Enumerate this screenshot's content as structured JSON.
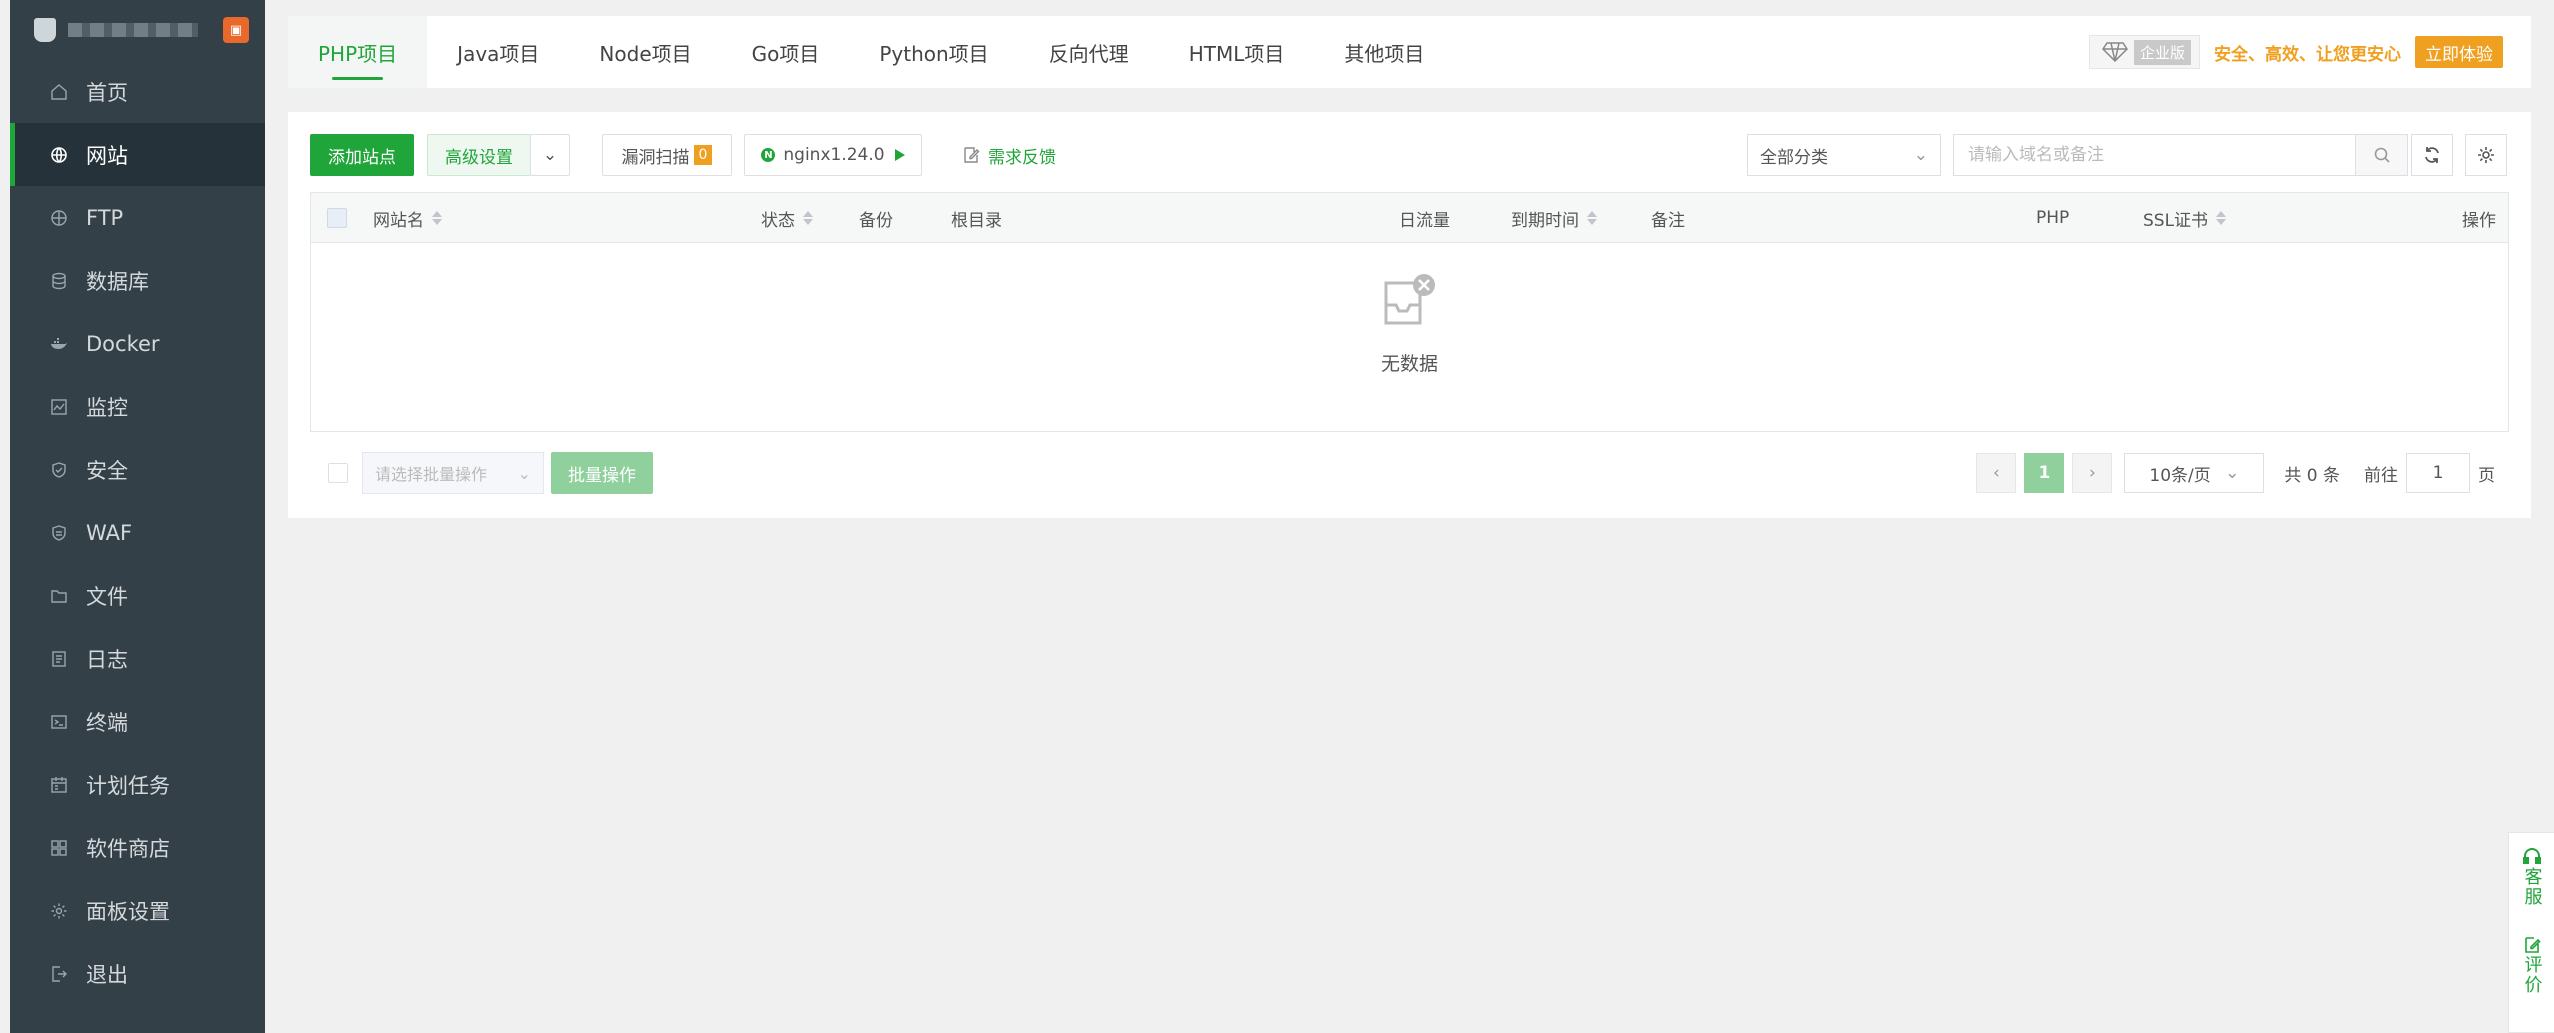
{
  "sidebar": {
    "items": [
      {
        "label": "首页",
        "icon": "home-icon"
      },
      {
        "label": "网站",
        "icon": "globe-icon"
      },
      {
        "label": "FTP",
        "icon": "ftp-icon"
      },
      {
        "label": "数据库",
        "icon": "database-icon"
      },
      {
        "label": "Docker",
        "icon": "docker-icon"
      },
      {
        "label": "监控",
        "icon": "monitor-icon"
      },
      {
        "label": "安全",
        "icon": "shield-icon"
      },
      {
        "label": "WAF",
        "icon": "waf-icon"
      },
      {
        "label": "文件",
        "icon": "folder-icon"
      },
      {
        "label": "日志",
        "icon": "log-icon"
      },
      {
        "label": "终端",
        "icon": "terminal-icon"
      },
      {
        "label": "计划任务",
        "icon": "calendar-icon"
      },
      {
        "label": "软件商店",
        "icon": "grid-icon"
      },
      {
        "label": "面板设置",
        "icon": "gear-icon"
      },
      {
        "label": "退出",
        "icon": "logout-icon"
      }
    ],
    "active_index": 1
  },
  "tabs": [
    "PHP项目",
    "Java项目",
    "Node项目",
    "Go项目",
    "Python项目",
    "反向代理",
    "HTML项目",
    "其他项目"
  ],
  "promo": {
    "edition": "企业版",
    "slogan": "安全、高效、让您更安心",
    "try_label": "立即体验"
  },
  "toolbar": {
    "add_site": "添加站点",
    "advanced": "高级设置",
    "vuln_scan": "漏洞扫描",
    "vuln_count": "0",
    "nginx": "nginx1.24.0",
    "feedback": "需求反馈",
    "category": "全部分类",
    "search_placeholder": "请输入域名或备注"
  },
  "table": {
    "columns": [
      "网站名",
      "状态",
      "备份",
      "根目录",
      "日流量",
      "到期时间",
      "备注",
      "PHP",
      "SSL证书",
      "操作"
    ],
    "rows": [],
    "empty_text": "无数据"
  },
  "footer": {
    "batch_placeholder": "请选择批量操作",
    "batch_button": "批量操作"
  },
  "pagination": {
    "current": "1",
    "page_size": "10条/页",
    "total_text": "共 0 条",
    "goto_label": "前往",
    "goto_value": "1",
    "page_suffix": "页"
  },
  "float": {
    "service": "客服",
    "review": "评价"
  },
  "colors": {
    "accent": "#20a53a",
    "sidebar_bg": "#334048",
    "promo": "#f0a020"
  }
}
